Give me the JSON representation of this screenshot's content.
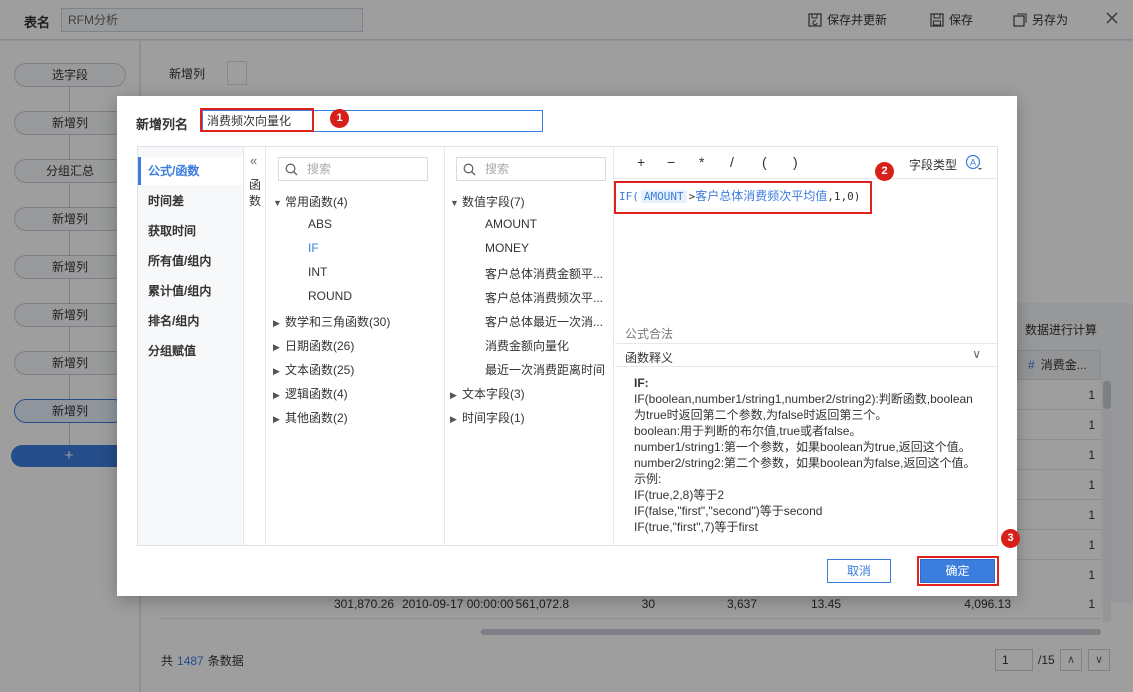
{
  "colors": {
    "accent": "#3b7ddd",
    "highlight": "#e0211c",
    "badge": "#d7201a"
  },
  "topbar": {
    "table_name_label": "表名",
    "table_name_value": "RFM分析",
    "save_update_label": "保存并更新",
    "save_label": "保存",
    "save_as_label": "另存为",
    "icons": {
      "save_update": "save-refresh-icon",
      "save": "save-icon",
      "save_as": "save-as-icon",
      "close": "close-icon"
    }
  },
  "flow": {
    "nodes": [
      "选字段",
      "新增列",
      "分组汇总",
      "新增列",
      "新增列",
      "新增列",
      "新增列",
      "新增列"
    ],
    "add_label": "+"
  },
  "right_panel": {
    "new_col_label": "新增列",
    "table_header_text": "数据进行计算",
    "column_header": "消费金...",
    "cells": [
      "1",
      "1",
      "1",
      "1",
      "1",
      "1",
      "1"
    ],
    "last_row": [
      "301,870.26",
      "2010-09-17 00:00:00",
      "561,072.8",
      "30",
      "3,637",
      "13.45",
      "4,096.13",
      "1"
    ],
    "footer_prefix": "共",
    "footer_count": "1487",
    "footer_suffix": "条数据",
    "page_current": "1",
    "page_total": "/15"
  },
  "dialog": {
    "name_label": "新增列名",
    "name_value": "消费频次向量化",
    "categories": [
      "公式/函数",
      "时间差",
      "获取时间",
      "所有值/组内",
      "累计值/组内",
      "排名/组内",
      "分组赋值"
    ],
    "collapse_chevron": "«",
    "collapse_text": "函数",
    "fn_search_placeholder": "搜索",
    "fld_search_placeholder": "搜索",
    "function_groups": [
      {
        "label": "常用函数(4)",
        "expanded": true,
        "items": [
          "ABS",
          "IF",
          "INT",
          "ROUND"
        ],
        "selected": "IF"
      },
      {
        "label": "数学和三角函数(30)",
        "expanded": false
      },
      {
        "label": "日期函数(26)",
        "expanded": false
      },
      {
        "label": "文本函数(25)",
        "expanded": false
      },
      {
        "label": "逻辑函数(4)",
        "expanded": false
      },
      {
        "label": "其他函数(2)",
        "expanded": false
      }
    ],
    "field_groups": [
      {
        "label": "数值字段(7)",
        "expanded": true,
        "items": [
          "AMOUNT",
          "MONEY",
          "客户总体消费金额平...",
          "客户总体消费频次平...",
          "客户总体最近一次消...",
          "消费金额向量化",
          "最近一次消费距离时间"
        ]
      },
      {
        "label": "文本字段(3)",
        "expanded": false
      },
      {
        "label": "时间字段(1)",
        "expanded": false
      }
    ],
    "operators": [
      "+",
      "−",
      "*",
      "/",
      "(",
      ")"
    ],
    "field_type_label": "字段类型",
    "field_type_icon": "text-type-A-icon",
    "formula": {
      "fn": "IF(",
      "field": "AMOUNT",
      "op": ">",
      "ref": "客户总体消费频次平均值",
      "rest": ",1,0)"
    },
    "validity_text": "公式合法",
    "desc_title": "函数释义",
    "desc_lines": [
      "IF:",
      "IF(boolean,number1/string1,number2/string2):判断函数,boolean",
      "为true时返回第二个参数,为false时返回第三个。",
      "boolean:用于判断的布尔值,true或者false。",
      "number1/string1:第一个参数，如果boolean为true,返回这个值。",
      "number2/string2:第二个参数，如果boolean为false,返回这个值。",
      "示例:",
      "IF(true,2,8)等于2",
      "IF(false,\"first\",\"second\")等于second",
      "IF(true,\"first\",7)等于first"
    ],
    "cancel_label": "取消",
    "ok_label": "确定",
    "badges": [
      "1",
      "2",
      "3"
    ]
  }
}
